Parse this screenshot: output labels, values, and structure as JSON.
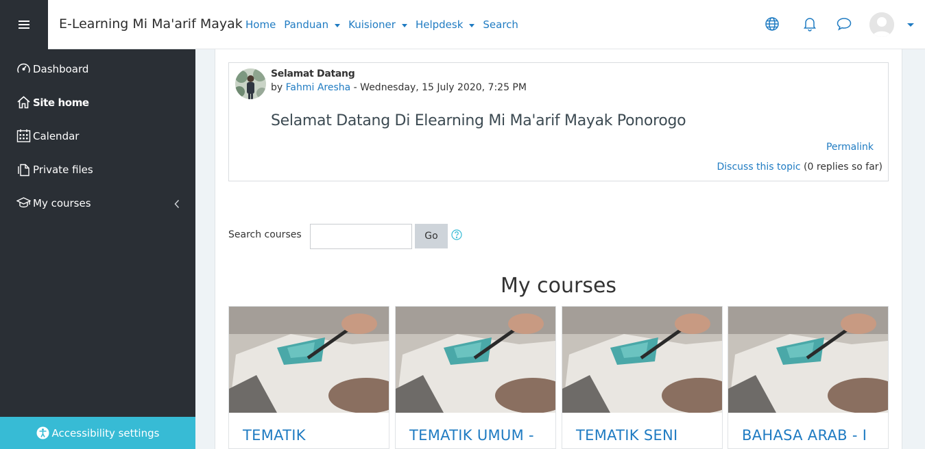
{
  "header": {
    "site_name": "E-Learning Mi Ma'arif Mayak",
    "nav": [
      {
        "label": "Home",
        "dropdown": false
      },
      {
        "label": "Panduan",
        "dropdown": true
      },
      {
        "label": "Kuisioner",
        "dropdown": true
      },
      {
        "label": "Helpdesk",
        "dropdown": true
      },
      {
        "label": "Search",
        "dropdown": false
      }
    ],
    "icons": [
      "menu-icon",
      "globe-icon",
      "bell-icon",
      "chat-icon",
      "user-avatar"
    ]
  },
  "sidebar": {
    "items": [
      {
        "label": "Dashboard",
        "icon": "dashboard-icon"
      },
      {
        "label": "Site home",
        "icon": "home-icon",
        "active": true
      },
      {
        "label": "Calendar",
        "icon": "calendar-icon"
      },
      {
        "label": "Private files",
        "icon": "files-icon"
      },
      {
        "label": "My courses",
        "icon": "graduation-cap-icon",
        "expandable": true
      }
    ],
    "accessibility_label": "Accessibility settings"
  },
  "post": {
    "subject": "Selamat Datang",
    "by_prefix": "by",
    "author": "Fahmi Aresha",
    "date": " - Wednesday, 15 July 2020, 7:25 PM",
    "message": "Selamat Datang Di Elearning Mi Ma'arif Mayak Ponorogo",
    "permalink": "Permalink",
    "discuss": "Discuss this topic",
    "replies": "(0 replies so far)"
  },
  "search": {
    "label": "Search courses",
    "value": "",
    "button": "Go"
  },
  "courses": {
    "title": "My courses",
    "items": [
      {
        "name": "TEMATIK"
      },
      {
        "name": "TEMATIK UMUM -"
      },
      {
        "name": "TEMATIK SENI"
      },
      {
        "name": "BAHASA ARAB - I"
      }
    ]
  },
  "colors": {
    "sidebar_bg": "#2a2f35",
    "link": "#1f7bc2",
    "accessibility_bg": "#37bbd5"
  }
}
